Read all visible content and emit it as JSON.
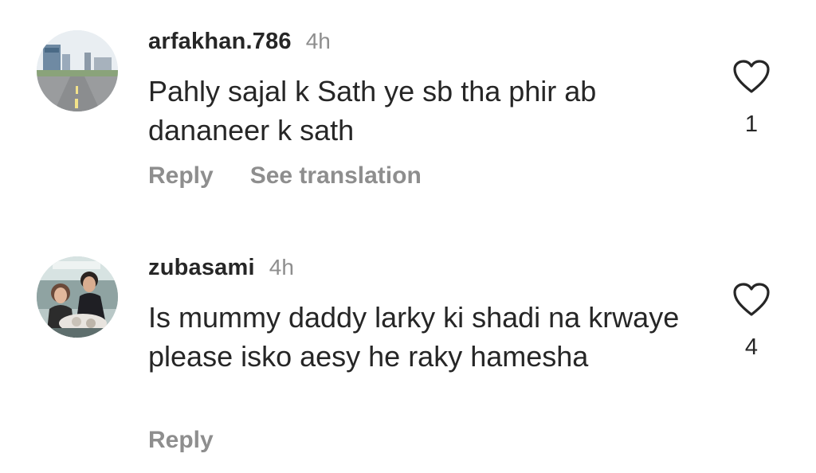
{
  "comments": [
    {
      "username": "arfakhan.786",
      "time": "4h",
      "text": "Pahly sajal k Sath ye sb tha phir ab dananeer k sath",
      "like_count": "1",
      "actions": {
        "reply": "Reply",
        "translate": "See translation"
      },
      "avatar_icon": "avatar-road-city-photo"
    },
    {
      "username": "zubasami",
      "time": "4h",
      "text": "Is mummy daddy larky ki shadi na krwaye please isko aesy he raky hamesha",
      "like_count": "4",
      "actions": {
        "reply": "Reply"
      },
      "avatar_icon": "avatar-couple-photo"
    }
  ],
  "icons": {
    "like": "heart-outline-icon"
  },
  "colors": {
    "text_primary": "#262626",
    "text_secondary": "#8e8e8e",
    "background": "#ffffff"
  }
}
